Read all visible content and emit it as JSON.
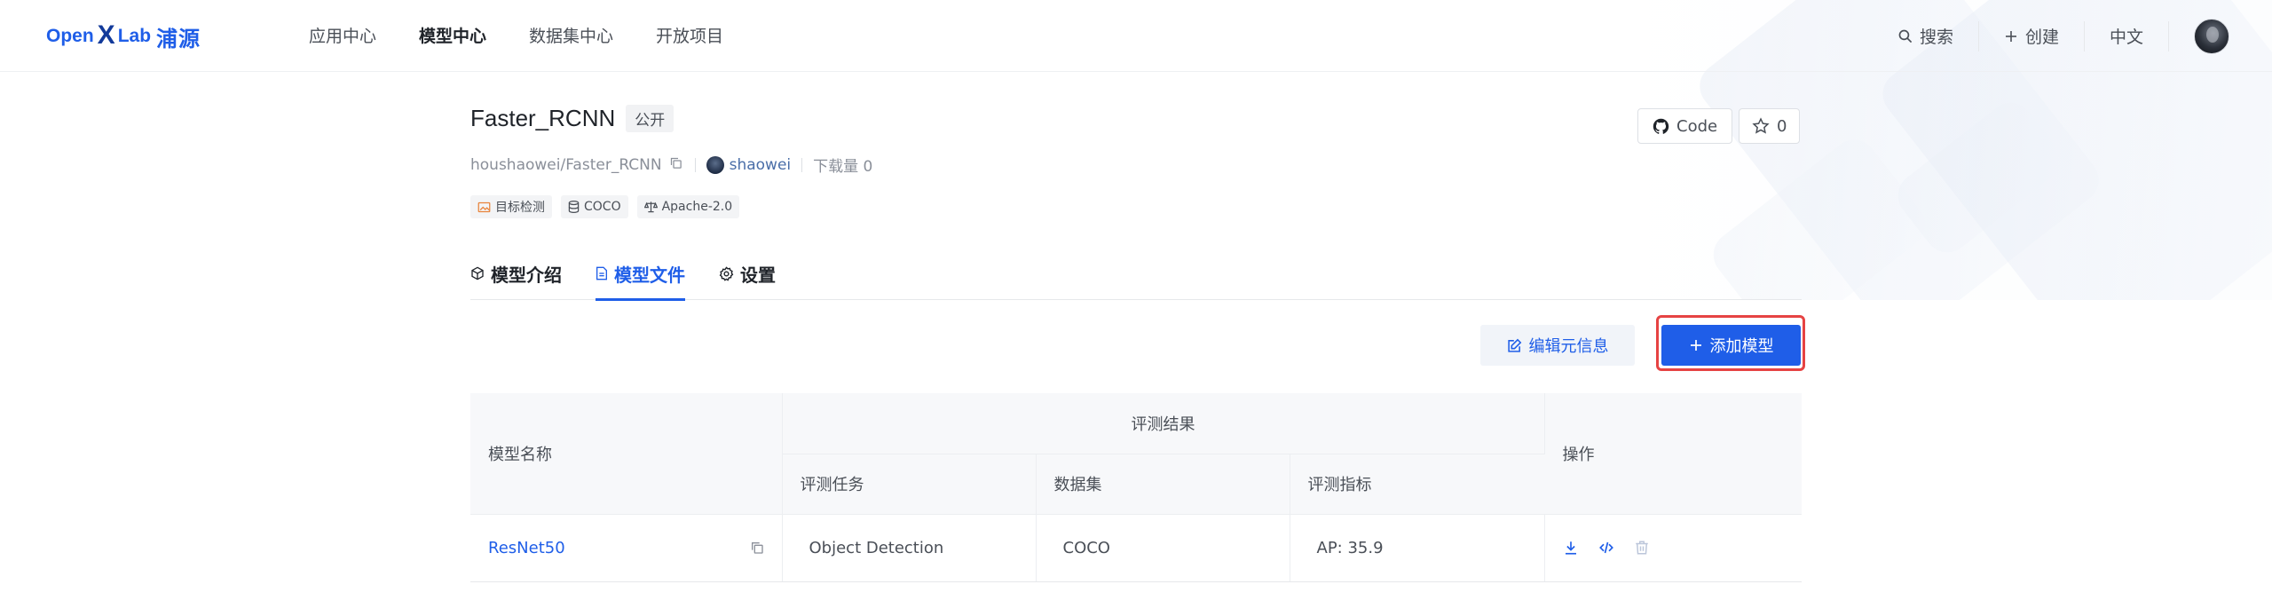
{
  "header": {
    "logo": {
      "part1": "Open",
      "part2": "Lab",
      "brand_cn": "浦源"
    },
    "nav": [
      {
        "label": "应用中心",
        "active": false
      },
      {
        "label": "模型中心",
        "active": true
      },
      {
        "label": "数据集中心",
        "active": false
      },
      {
        "label": "开放项目",
        "active": false
      }
    ],
    "search_label": "搜索",
    "create_label": "创建",
    "language_label": "中文"
  },
  "repo": {
    "name": "Faster_RCNN",
    "visibility": "公开",
    "path": "houshaowei/Faster_RCNN",
    "owner": "shaowei",
    "downloads": "下载量 0",
    "tags": [
      {
        "icon": "image-icon",
        "label": "目标检测"
      },
      {
        "icon": "database-icon",
        "label": "COCO"
      },
      {
        "icon": "scale-icon",
        "label": "Apache-2.0"
      }
    ],
    "code_label": "Code",
    "star_count": "0"
  },
  "tabs": [
    {
      "icon": "cube-icon",
      "label": "模型介绍",
      "active": false
    },
    {
      "icon": "file-icon",
      "label": "模型文件",
      "active": true
    },
    {
      "icon": "gear-icon",
      "label": "设置",
      "active": false
    }
  ],
  "actions": {
    "edit_meta_label": "编辑元信息",
    "add_model_label": "添加模型"
  },
  "table": {
    "headers": {
      "model_name": "模型名称",
      "eval_results": "评测结果",
      "eval_task": "评测任务",
      "dataset": "数据集",
      "eval_metric": "评测指标",
      "operations": "操作"
    },
    "rows": [
      {
        "model_name": "ResNet50",
        "task": "Object Detection",
        "dataset": "COCO",
        "metric": "AP: 35.9"
      }
    ]
  },
  "colors": {
    "accent": "#1f5ee8",
    "highlight": "#e64343"
  }
}
